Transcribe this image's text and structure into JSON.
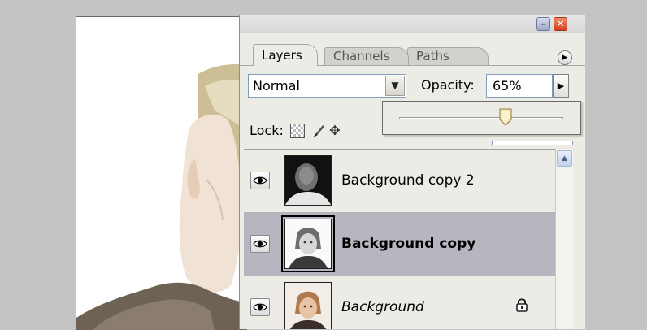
{
  "palette": {
    "tabs": [
      {
        "label": "Layers",
        "active": true
      },
      {
        "label": "Channels",
        "active": false
      },
      {
        "label": "Paths",
        "active": false
      }
    ],
    "blend_mode": "Normal",
    "opacity_label": "Opacity:",
    "opacity_value": "65%",
    "opacity_slider_fraction": 0.65,
    "lock_label": "Lock:",
    "icons": {
      "minimize": "minimize-icon",
      "close": "close-icon",
      "menu": "palette-menu-icon",
      "dropdown": "chevron-down-icon",
      "slider_toggle": "chevron-right-icon",
      "lock_transparency": "checkerboard-icon",
      "lock_image": "brush-icon",
      "lock_position": "move-icon",
      "visibility": "eye-icon",
      "layer_lock": "padlock-icon"
    },
    "layers": [
      {
        "name": "Background copy 2",
        "selected": false,
        "style": "normal",
        "locked": false
      },
      {
        "name": "Background copy",
        "selected": true,
        "style": "bold",
        "locked": false
      },
      {
        "name": "Background",
        "selected": false,
        "style": "italic",
        "locked": true
      }
    ]
  },
  "colors": {
    "selected_row": "#b6b5c0",
    "panel": "#ecebe6",
    "close_button": "#d6401e"
  }
}
